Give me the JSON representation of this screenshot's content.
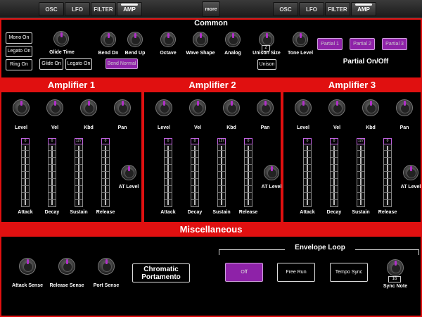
{
  "top_tabs_left": [
    "OSC",
    "LFO",
    "FILTER",
    "AMP"
  ],
  "top_tabs_right": [
    "OSC",
    "LFO",
    "FILTER",
    "AMP"
  ],
  "more_label": "more",
  "common": {
    "title": "Common",
    "mono_on": "Mono On",
    "legato_on": "Legato On",
    "ring_on": "Ring On",
    "glide_time": "Glide Time",
    "glide_on": "Glide On",
    "legato_on_2": "Legato On",
    "bend_dn": "Bend Dn",
    "bend_up": "Bend Up",
    "bend_normal": "Bend Normal",
    "octave": "Octave",
    "wave_shape": "Wave Shape",
    "analog": "Analog",
    "unison_size": "Unison Size",
    "unison_value": "2",
    "unison": "Unison",
    "tone_level": "Tone Level",
    "partials": [
      "Partial 1",
      "Partial 2",
      "Partial 3"
    ],
    "partial_onoff": "Partial On/Off"
  },
  "amps": [
    {
      "title": "Amplifier 1",
      "knobs": [
        "Level",
        "Vel",
        "Kbd",
        "Pan"
      ],
      "faders": [
        "Attack",
        "Decay",
        "Sustain",
        "Release"
      ],
      "fader_values": [
        "0",
        "0",
        "127",
        "0"
      ],
      "at_level": "AT Level"
    },
    {
      "title": "Amplifier 2",
      "knobs": [
        "Level",
        "Vel",
        "Kbd",
        "Pan"
      ],
      "faders": [
        "Attack",
        "Decay",
        "Sustain",
        "Release"
      ],
      "fader_values": [
        "0",
        "0",
        "127",
        "0"
      ],
      "at_level": "AT Level"
    },
    {
      "title": "Amplifier 3",
      "knobs": [
        "Level",
        "Vel",
        "Kbd",
        "Pan"
      ],
      "faders": [
        "Attack",
        "Decay",
        "Sustain",
        "Release"
      ],
      "fader_values": [
        "0",
        "0",
        "127",
        "0"
      ],
      "at_level": "AT Level"
    }
  ],
  "misc": {
    "title": "Miscellaneous",
    "attack_sense": "Attack Sense",
    "release_sense": "Release Sense",
    "port_sense": "Port Sense",
    "chromatic_portamento": "Chromatic Portamento",
    "envelope_loop": "Envelope Loop",
    "loop_off": "Off",
    "free_run": "Free Run",
    "tempo_sync": "Tempo Sync",
    "sync_note": "Sync Note",
    "sync_note_value": "16"
  }
}
